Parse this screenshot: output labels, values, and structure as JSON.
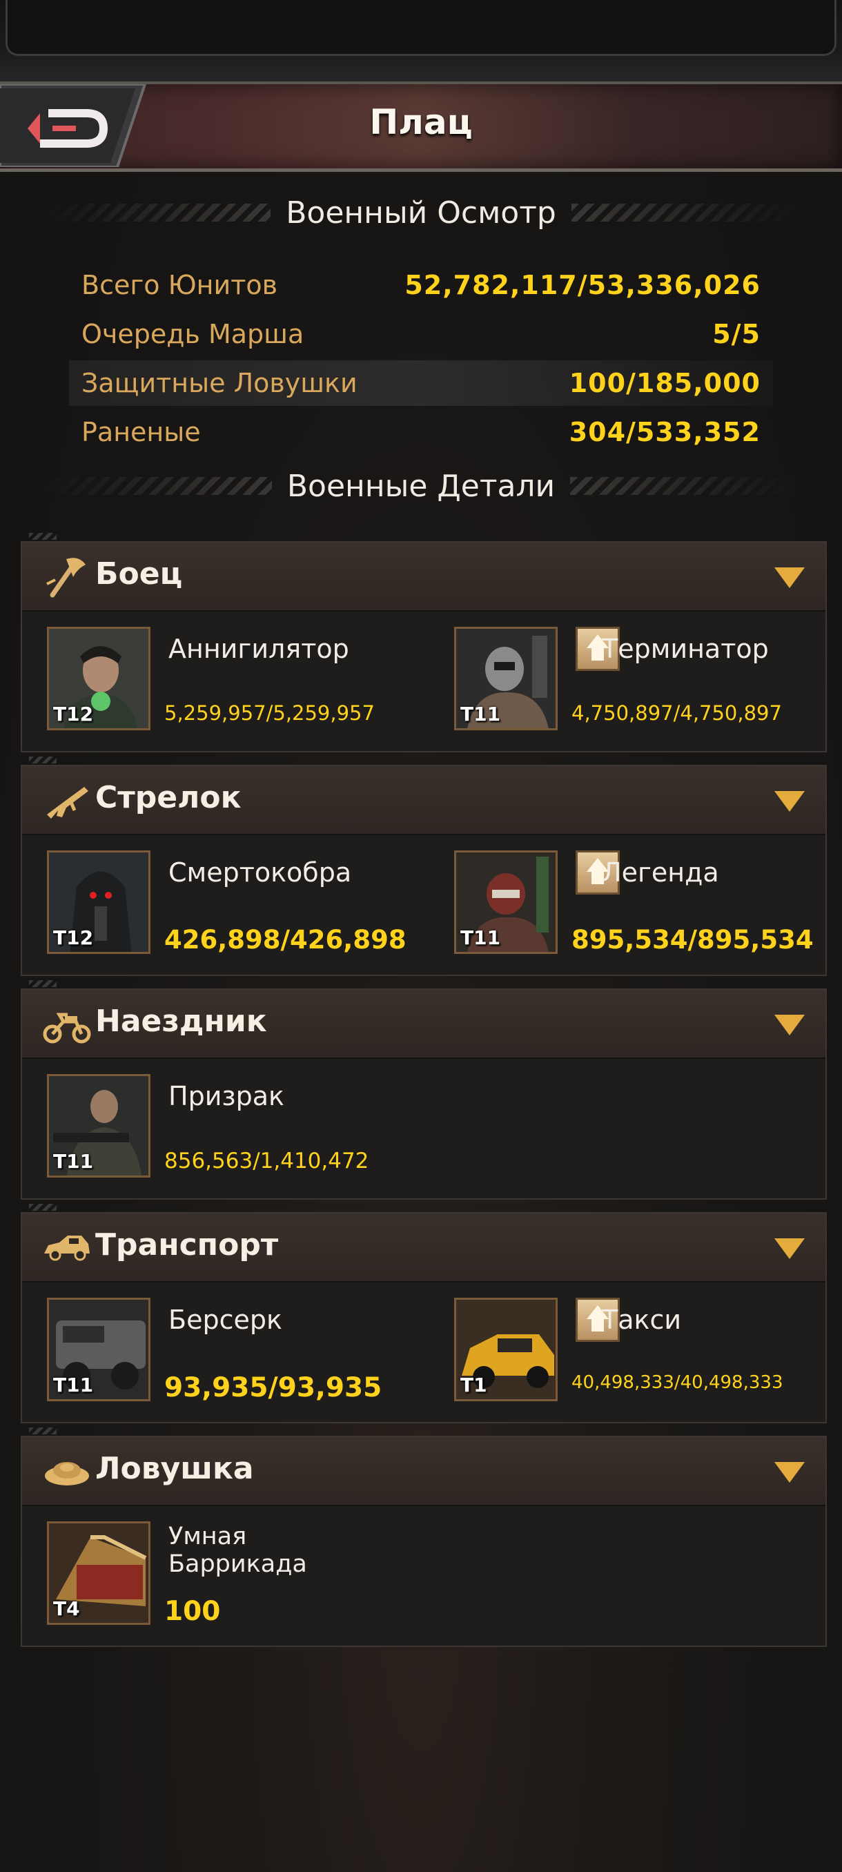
{
  "header": {
    "title": "Плац",
    "back_icon": "back-arrow-icon"
  },
  "overview": {
    "heading": "Военный Осмотр",
    "stats": [
      {
        "label": "Всего Юнитов",
        "value": "52,782,117/53,336,026"
      },
      {
        "label": "Очередь Марша",
        "value": "5/5"
      },
      {
        "label": "Защитные Ловушки",
        "value": "100/185,000"
      },
      {
        "label": "Раненые",
        "value": "304/533,352"
      }
    ]
  },
  "details": {
    "heading": "Военные Детали",
    "groups": [
      {
        "title": "Боец",
        "icon": "axe-icon",
        "units": [
          {
            "name": "Аннигилятор",
            "tier": "T12",
            "count": "5,259,957/5,259,957",
            "upgrade": false
          },
          {
            "name": "Терминатор",
            "tier": "T11",
            "count": "4,750,897/4,750,897",
            "upgrade": true
          }
        ]
      },
      {
        "title": "Стрелок",
        "icon": "rifle-icon",
        "units": [
          {
            "name": "Смертокобра",
            "tier": "T12",
            "count": "426,898/426,898",
            "upgrade": false
          },
          {
            "name": "Легенда",
            "tier": "T11",
            "count": "895,534/895,534",
            "upgrade": true
          }
        ]
      },
      {
        "title": "Наездник",
        "icon": "motorcycle-icon",
        "units": [
          {
            "name": "Призрак",
            "tier": "T11",
            "count": "856,563/1,410,472",
            "upgrade": false
          }
        ]
      },
      {
        "title": "Транспорт",
        "icon": "car-icon",
        "units": [
          {
            "name": "Берсерк",
            "tier": "T11",
            "count": "93,935/93,935",
            "upgrade": false
          },
          {
            "name": "Такси",
            "tier": "T1",
            "count": "40,498,333/40,498,333",
            "upgrade": true
          }
        ]
      },
      {
        "title": "Ловушка",
        "icon": "trap-mine-icon",
        "units": [
          {
            "name": "Умная Баррикада",
            "tier": "T4",
            "count": "100",
            "upgrade": false
          }
        ]
      }
    ]
  },
  "colors": {
    "accent_gold": "#ffd21c",
    "label_orange": "#d9a85c",
    "arrow": "#e5ab3c"
  }
}
